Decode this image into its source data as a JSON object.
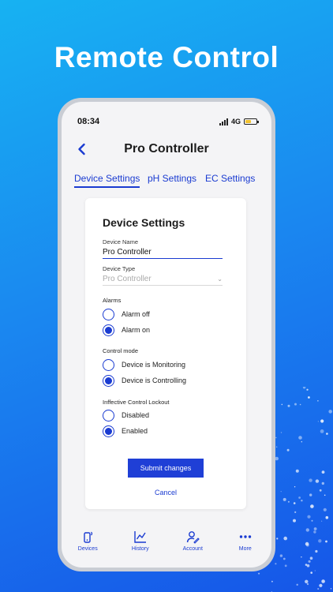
{
  "promo": {
    "headline": "Remote Control"
  },
  "status": {
    "time": "08:34",
    "network": "4G"
  },
  "header": {
    "title": "Pro Controller",
    "back_icon": "chevron-left-icon"
  },
  "tabs": [
    {
      "label": "Device Settings",
      "active": true
    },
    {
      "label": "pH Settings",
      "active": false
    },
    {
      "label": "EC Settings",
      "active": false
    }
  ],
  "card": {
    "title": "Device Settings",
    "device_name": {
      "label": "Device Name",
      "value": "Pro Controller"
    },
    "device_type": {
      "label": "Device Type",
      "value": "Pro Controller"
    },
    "alarms": {
      "label": "Alarms",
      "options": [
        {
          "label": "Alarm off",
          "checked": false
        },
        {
          "label": "Alarm on",
          "checked": true
        }
      ]
    },
    "control_mode": {
      "label": "Control mode",
      "options": [
        {
          "label": "Device is Monitoring",
          "checked": false
        },
        {
          "label": "Device is Controlling",
          "checked": true
        }
      ]
    },
    "lockout": {
      "label": "Inffective Control Lockout",
      "options": [
        {
          "label": "Disabled",
          "checked": false
        },
        {
          "label": "Enabled",
          "checked": true
        }
      ]
    },
    "submit_label": "Submit changes",
    "cancel_label": "Cancel"
  },
  "bottom_nav": [
    {
      "label": "Devices",
      "icon": "device-icon"
    },
    {
      "label": "History",
      "icon": "chart-icon"
    },
    {
      "label": "Account",
      "icon": "user-edit-icon"
    },
    {
      "label": "More",
      "icon": "more-dots-icon"
    }
  ],
  "colors": {
    "accent": "#1a3bd1",
    "button": "#1f3fd6",
    "battery": "#f2c12e"
  }
}
